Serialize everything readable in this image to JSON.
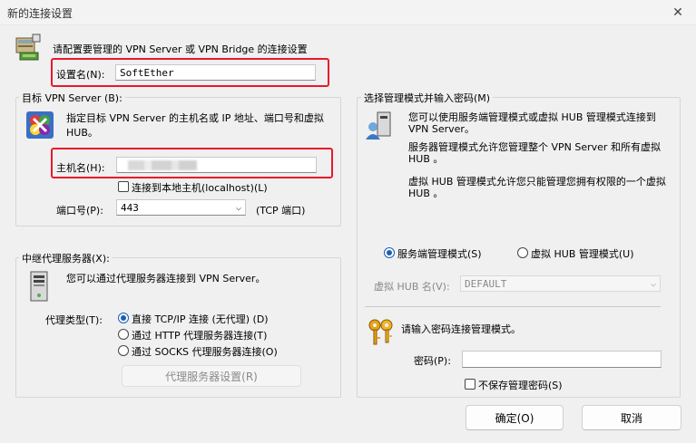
{
  "window": {
    "title": "新的连接设置"
  },
  "header": {
    "description": "请配置要管理的 VPN Server 或 VPN Bridge 的连接设置"
  },
  "setting_name": {
    "label": "设置名(N):",
    "value": "SoftEther"
  },
  "target": {
    "group_title": "目标 VPN Server (B):",
    "description": "指定目标 VPN Server 的主机名或 IP 地址、端口号和虚拟 HUB。",
    "host_label": "主机名(H):",
    "host_value": "",
    "localhost_label": "连接到本地主机(localhost)(L)",
    "port_label": "端口号(P):",
    "port_value": "443",
    "port_suffix": "(TCP 端口)"
  },
  "proxy": {
    "group_title": "中继代理服务器(X):",
    "description": "您可以通过代理服务器连接到 VPN Server。",
    "type_label": "代理类型(T):",
    "options": [
      "直接 TCP/IP 连接 (无代理) (D)",
      "通过 HTTP 代理服务器连接(T)",
      "通过 SOCKS 代理服务器连接(O)"
    ],
    "settings_button": "代理服务器设置(R)"
  },
  "mode": {
    "group_title": "选择管理模式并输入密码(M)",
    "desc1": "您可以使用服务端管理模式或虚拟 HUB 管理模式连接到 VPN Server。",
    "desc2": "服务器管理模式允许您管理整个 VPN Server 和所有虚拟 HUB 。",
    "desc3": "虚拟 HUB 管理模式允许您只能管理您拥有权限的一个虚拟 HUB 。",
    "server_mode_label": "服务端管理模式(S)",
    "hub_mode_label": "虚拟 HUB 管理模式(U)",
    "hub_name_label": "虚拟 HUB 名(V):",
    "hub_name_value": "DEFAULT",
    "password_prompt": "请输入密码连接管理模式。",
    "password_label": "密码(P):",
    "password_value": "",
    "no_save_label": "不保存管理密码(S)"
  },
  "footer": {
    "ok_button": "确定(O)",
    "cancel_button": "取消"
  },
  "icons": {
    "header": "server-config-icon",
    "target": "vpn-target-icon",
    "mode": "server-user-icon",
    "proxy": "computer-tower-icon",
    "password": "keys-icon"
  }
}
